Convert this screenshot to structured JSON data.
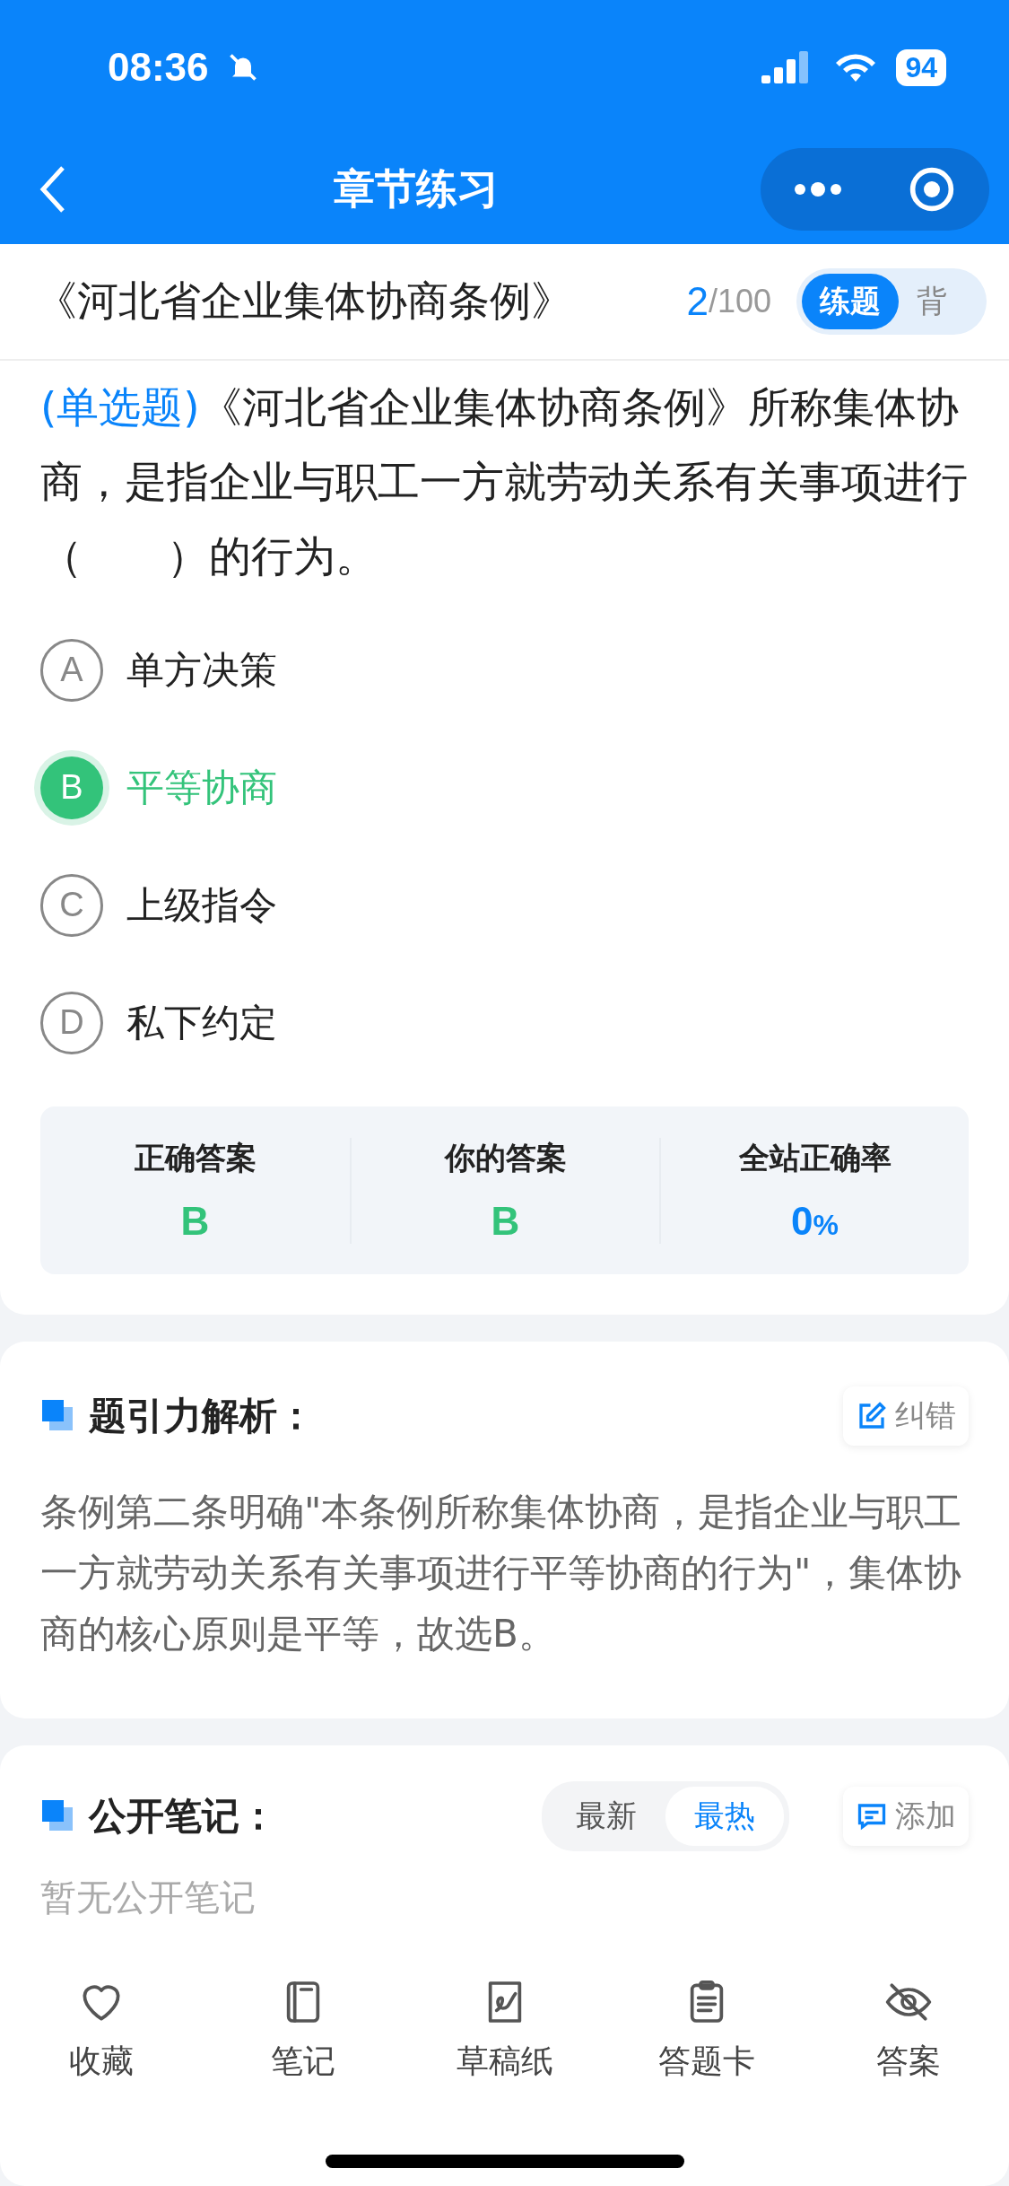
{
  "status_bar": {
    "time": "08:36",
    "battery": "94"
  },
  "nav": {
    "title": "章节练习"
  },
  "header": {
    "book": "《河北省企业集体协商条例》",
    "current": "2",
    "total": "/100",
    "modes": [
      {
        "label": "练题",
        "selected": true
      },
      {
        "label": "背",
        "selected": false
      }
    ]
  },
  "question": {
    "type": "(单选题)",
    "text": "《河北省企业集体协商条例》所称集体协商，是指企业与职工一方就劳动关系有关事项进行（　　）的行为。"
  },
  "options": [
    {
      "letter": "A",
      "text": "单方决策",
      "selected": false
    },
    {
      "letter": "B",
      "text": "平等协商",
      "selected": true
    },
    {
      "letter": "C",
      "text": "上级指令",
      "selected": false
    },
    {
      "letter": "D",
      "text": "私下约定",
      "selected": false
    }
  ],
  "result": [
    {
      "label": "正确答案",
      "value": "B",
      "kind": "answer"
    },
    {
      "label": "你的答案",
      "value": "B",
      "kind": "answer"
    },
    {
      "label": "全站正确率",
      "value": "0",
      "unit": "%",
      "kind": "rate"
    }
  ],
  "analysis": {
    "title": "题引力解析：",
    "action": "纠错",
    "text": "条例第二条明确\"本条例所称集体协商，是指企业与职工一方就劳动关系有关事项进行平等协商的行为\"，集体协商的核心原则是平等，故选B。"
  },
  "notes": {
    "title": "公开笔记：",
    "sorts": [
      {
        "label": "最新",
        "selected": false
      },
      {
        "label": "最热",
        "selected": true
      }
    ],
    "action": "添加",
    "empty": "暂无公开笔记"
  },
  "toolbar": [
    {
      "label": "收藏",
      "kind": "heart"
    },
    {
      "label": "笔记",
      "kind": "notebook"
    },
    {
      "label": "草稿纸",
      "kind": "draft"
    },
    {
      "label": "答题卡",
      "kind": "clipboard"
    },
    {
      "label": "答案",
      "kind": "eye"
    }
  ]
}
